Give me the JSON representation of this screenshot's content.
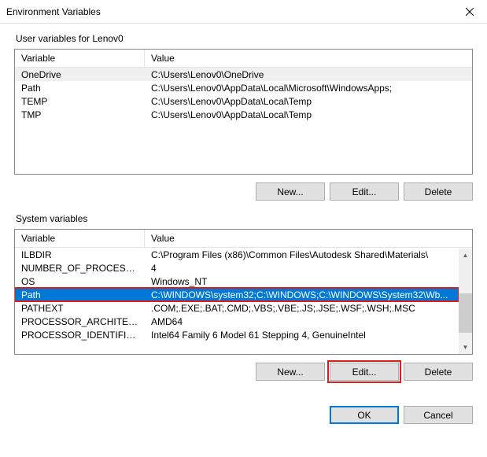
{
  "dialog": {
    "title": "Environment Variables"
  },
  "user_section": {
    "label": "User variables for Lenov0",
    "headers": {
      "variable": "Variable",
      "value": "Value"
    },
    "rows": [
      {
        "variable": "OneDrive",
        "value": "C:\\Users\\Lenov0\\OneDrive"
      },
      {
        "variable": "Path",
        "value": "C:\\Users\\Lenov0\\AppData\\Local\\Microsoft\\WindowsApps;"
      },
      {
        "variable": "TEMP",
        "value": "C:\\Users\\Lenov0\\AppData\\Local\\Temp"
      },
      {
        "variable": "TMP",
        "value": "C:\\Users\\Lenov0\\AppData\\Local\\Temp"
      }
    ],
    "buttons": {
      "new": "New...",
      "edit": "Edit...",
      "delete": "Delete"
    }
  },
  "system_section": {
    "label": "System variables",
    "headers": {
      "variable": "Variable",
      "value": "Value"
    },
    "rows": [
      {
        "variable": "ILBDIR",
        "value": "C:\\Program Files (x86)\\Common Files\\Autodesk Shared\\Materials\\"
      },
      {
        "variable": "NUMBER_OF_PROCESSORS",
        "value": "4"
      },
      {
        "variable": "OS",
        "value": "Windows_NT"
      },
      {
        "variable": "Path",
        "value": "C:\\WINDOWS\\system32;C:\\WINDOWS;C:\\WINDOWS\\System32\\Wb..."
      },
      {
        "variable": "PATHEXT",
        "value": ".COM;.EXE;.BAT;.CMD;.VBS;.VBE;.JS;.JSE;.WSF;.WSH;.MSC"
      },
      {
        "variable": "PROCESSOR_ARCHITECTURE",
        "value": "AMD64"
      },
      {
        "variable": "PROCESSOR_IDENTIFIER",
        "value": "Intel64 Family 6 Model 61 Stepping 4, GenuineIntel"
      }
    ],
    "selected_index": 3,
    "buttons": {
      "new": "New...",
      "edit": "Edit...",
      "delete": "Delete"
    }
  },
  "dialog_buttons": {
    "ok": "OK",
    "cancel": "Cancel"
  }
}
